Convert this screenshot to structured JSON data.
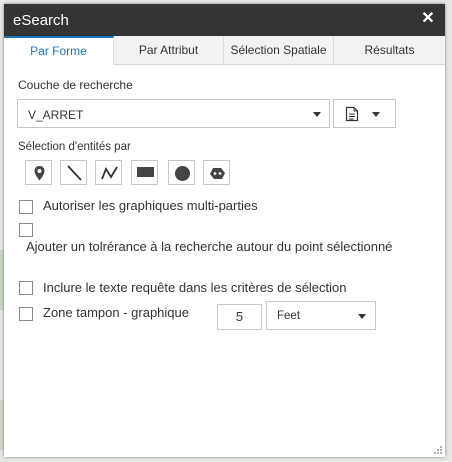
{
  "window": {
    "title": "eSearch"
  },
  "tabs": [
    {
      "label": "Par Forme",
      "active": true
    },
    {
      "label": "Par Attribut",
      "active": false
    },
    {
      "label": "Sélection Spatiale",
      "active": false
    },
    {
      "label": "Résultats",
      "active": false
    }
  ],
  "search_layer": {
    "label": "Couche de recherche",
    "selected": "V_ARRET"
  },
  "selection_by": {
    "label": "Sélection d'entités par",
    "tools": [
      "point-icon",
      "line-icon",
      "polyline-icon",
      "rectangle-icon",
      "circle-icon",
      "polygon-icon"
    ]
  },
  "options": {
    "multipart": "Autoriser les graphiques multi-parties",
    "tolerance": "Ajouter un tolrérance à la recherche autour du point sélectionné",
    "include_text": "Inclure le texte requête dans les critères de sélection",
    "buffer": "Zone tampon - graphique"
  },
  "buffer": {
    "distance": "5",
    "unit": "Feet"
  },
  "colors": {
    "titlebar": "#343434",
    "accent": "#1f73b7"
  }
}
